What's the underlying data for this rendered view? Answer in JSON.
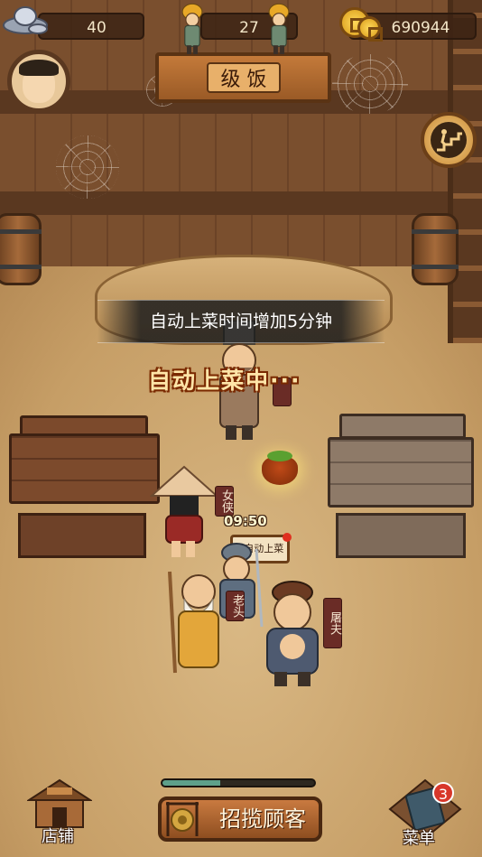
{
  "topbar": {
    "silver_value": "40",
    "workers_value": "27",
    "coins_value": "690944"
  },
  "toast": {
    "message": "自动上菜时间增加5分钟"
  },
  "status": {
    "auto_serving": "自动上菜中···"
  },
  "characters": [
    {
      "name": "女侠",
      "role": "customer"
    },
    {
      "name": "老头",
      "role": "customer"
    },
    {
      "name": "屠夫",
      "role": "customer"
    }
  ],
  "serve_bubble": {
    "label": "▶自动上菜",
    "timer": "09:50"
  },
  "bottom": {
    "shop_label": "店铺",
    "recruit_label": "招揽顾客",
    "recruit_progress": 0.38,
    "menu_label": "菜单",
    "menu_badge": "3"
  }
}
